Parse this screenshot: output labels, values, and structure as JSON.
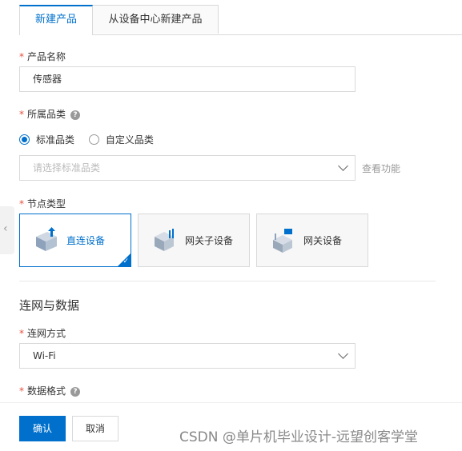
{
  "tabs": [
    {
      "label": "新建产品",
      "active": true
    },
    {
      "label": "从设备中心新建产品",
      "active": false
    }
  ],
  "form": {
    "product_name": {
      "label": "产品名称",
      "value": "传感器"
    },
    "category": {
      "label": "所属品类",
      "options": [
        "标准品类",
        "自定义品类"
      ],
      "selected": "标准品类",
      "placeholder": "请选择标准品类",
      "link": "查看功能"
    },
    "node_type": {
      "label": "节点类型",
      "cards": [
        "直连设备",
        "网关子设备",
        "网关设备"
      ],
      "selected": "直连设备"
    },
    "network_section_title": "连网与数据",
    "network_mode": {
      "label": "连网方式",
      "value": "Wi-Fi"
    },
    "data_format": {
      "label": "数据格式"
    }
  },
  "footer": {
    "confirm": "确认",
    "cancel": "取消"
  },
  "watermark": "CSDN @单片机毕业设计-远望创客学堂",
  "colors": {
    "accent": "#0070cc",
    "required": "#e84e3d"
  }
}
